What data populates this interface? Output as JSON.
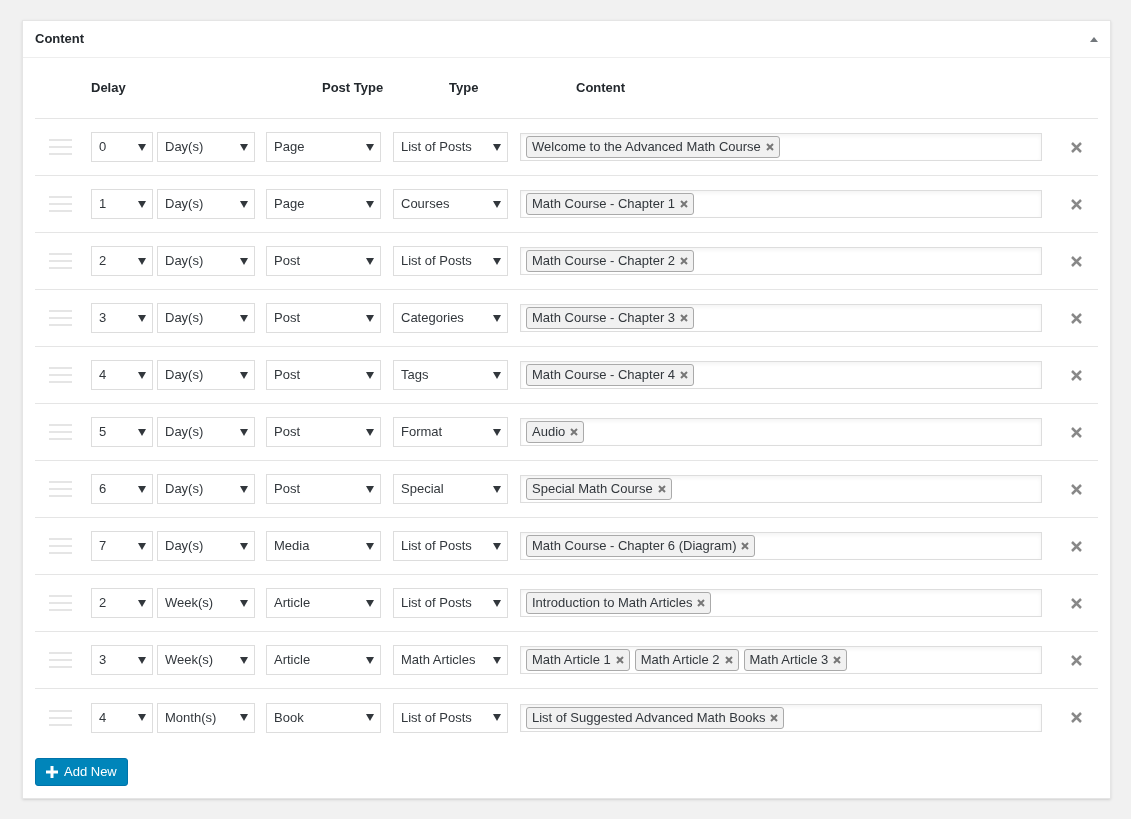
{
  "panel": {
    "title": "Content",
    "expanded": true
  },
  "columns": [
    "Delay",
    "Post Type",
    "Type",
    "Content"
  ],
  "rows": [
    {
      "delay": "0",
      "unit": "Day(s)",
      "post_type": "Page",
      "type": "List of Posts",
      "content": [
        "Welcome to the Advanced Math Course"
      ]
    },
    {
      "delay": "1",
      "unit": "Day(s)",
      "post_type": "Page",
      "type": "Courses",
      "content": [
        "Math Course - Chapter 1"
      ]
    },
    {
      "delay": "2",
      "unit": "Day(s)",
      "post_type": "Post",
      "type": "List of Posts",
      "content": [
        "Math Course - Chapter 2"
      ]
    },
    {
      "delay": "3",
      "unit": "Day(s)",
      "post_type": "Post",
      "type": "Categories",
      "content": [
        "Math Course - Chapter 3"
      ]
    },
    {
      "delay": "4",
      "unit": "Day(s)",
      "post_type": "Post",
      "type": "Tags",
      "content": [
        "Math Course - Chapter 4"
      ]
    },
    {
      "delay": "5",
      "unit": "Day(s)",
      "post_type": "Post",
      "type": "Format",
      "content": [
        "Audio"
      ]
    },
    {
      "delay": "6",
      "unit": "Day(s)",
      "post_type": "Post",
      "type": "Special",
      "content": [
        "Special Math Course"
      ]
    },
    {
      "delay": "7",
      "unit": "Day(s)",
      "post_type": "Media",
      "type": "List of Posts",
      "content": [
        "Math Course - Chapter 6 (Diagram)"
      ]
    },
    {
      "delay": "2",
      "unit": "Week(s)",
      "post_type": "Article",
      "type": "List of Posts",
      "content": [
        "Introduction to Math Articles"
      ]
    },
    {
      "delay": "3",
      "unit": "Week(s)",
      "post_type": "Article",
      "type": "Math Articles",
      "content": [
        "Math Article 1",
        "Math Article 2",
        "Math Article 3"
      ]
    },
    {
      "delay": "4",
      "unit": "Month(s)",
      "post_type": "Book",
      "type": "List of Posts",
      "content": [
        "List of Suggested Advanced Math Books"
      ]
    }
  ],
  "add_button": "Add New"
}
